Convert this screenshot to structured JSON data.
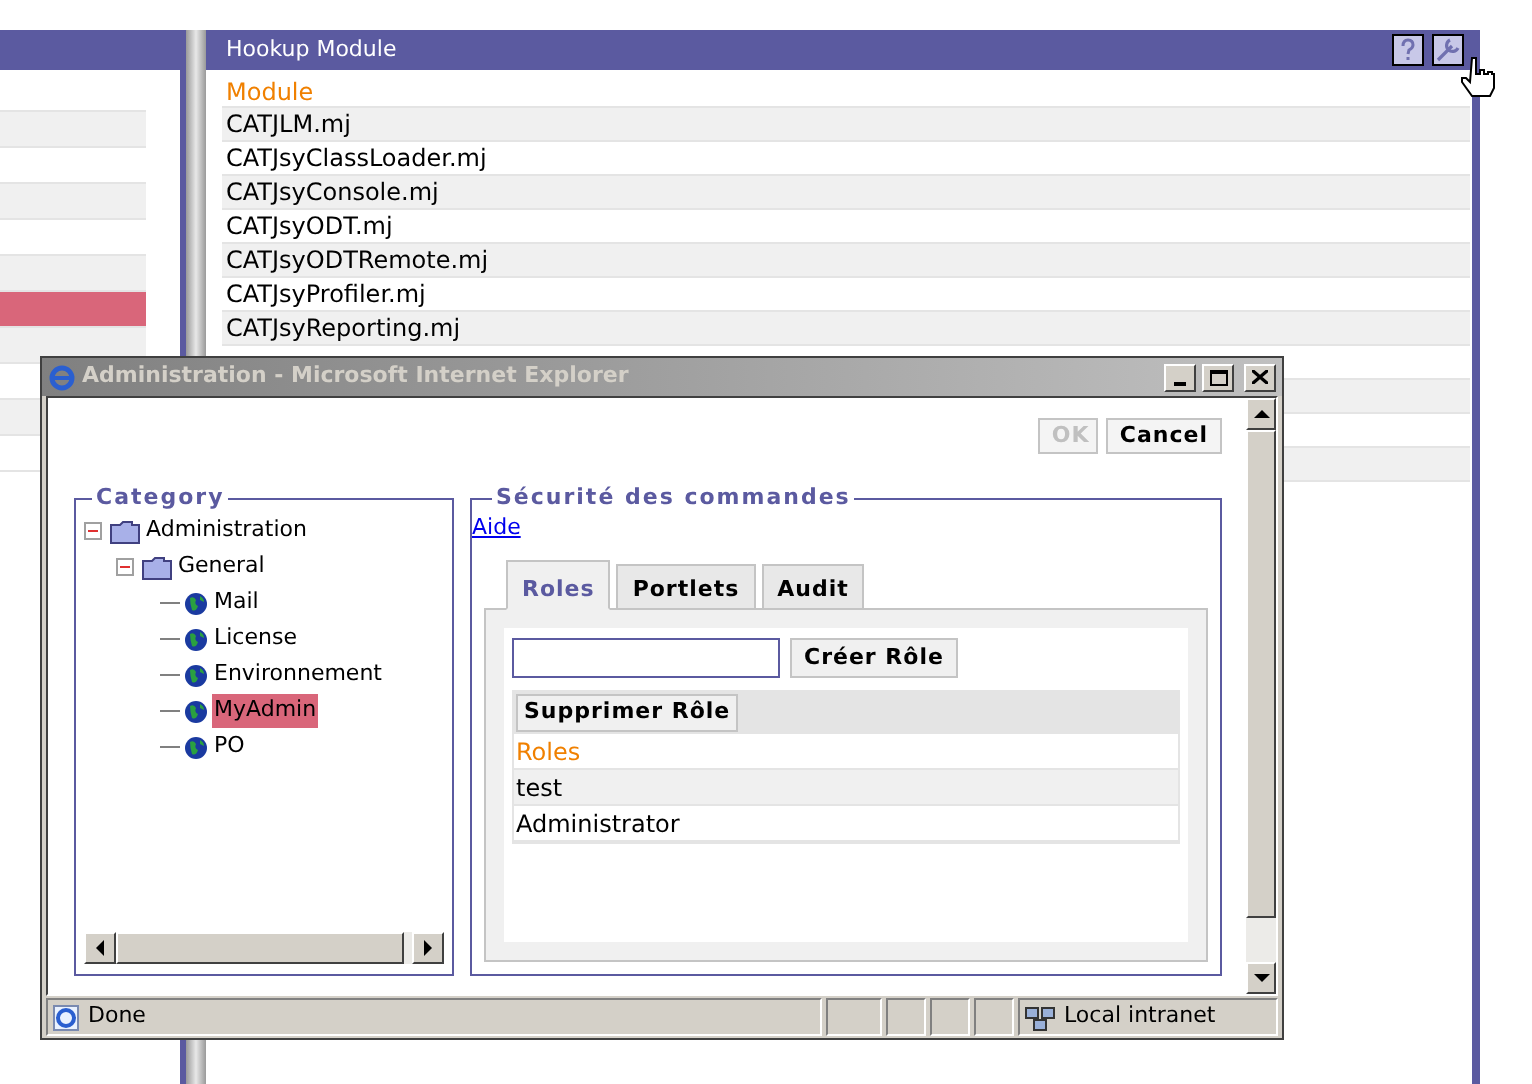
{
  "left_panel": {
    "rows": [
      {
        "selected": false
      },
      {
        "selected": false
      },
      {
        "selected": false
      },
      {
        "selected": false
      },
      {
        "selected": false
      },
      {
        "selected": false
      },
      {
        "selected": true
      },
      {
        "selected": false
      },
      {
        "selected": false
      },
      {
        "selected": false
      },
      {
        "selected": false
      }
    ]
  },
  "hookup_module": {
    "title": "Hookup Module",
    "column": "Module",
    "rows": [
      "CATJLM.mj",
      "CATJsyClassLoader.mj",
      "CATJsyConsole.mj",
      "CATJsyODT.mj",
      "CATJsyODTRemote.mj",
      "CATJsyProfiler.mj",
      "CATJsyReporting.mj"
    ]
  },
  "dialog": {
    "title": "Administration - Microsoft Internet Explorer",
    "active": false,
    "buttons": [
      {
        "label": "OK",
        "disabled": true
      },
      {
        "label": "Cancel",
        "disabled": false
      }
    ],
    "category": {
      "legend": "Category",
      "tree": [
        {
          "label": "Administration",
          "kind": "folder",
          "expanded": true,
          "children": [
            {
              "label": "General",
              "kind": "folder",
              "expanded": true,
              "children": [
                {
                  "label": "Mail",
                  "kind": "leaf",
                  "selected": false
                },
                {
                  "label": "License",
                  "kind": "leaf",
                  "selected": false
                },
                {
                  "label": "Environnement",
                  "kind": "leaf",
                  "selected": false
                },
                {
                  "label": "MyAdmin",
                  "kind": "leaf",
                  "selected": true
                },
                {
                  "label": "PO",
                  "kind": "leaf",
                  "selected": false
                }
              ]
            }
          ]
        }
      ]
    },
    "security": {
      "legend": "Sécurité des commandes",
      "help_link": "Aide",
      "tabs": [
        {
          "label": "Roles",
          "selected": true
        },
        {
          "label": "Portlets",
          "selected": false
        },
        {
          "label": "Audit",
          "selected": false
        }
      ],
      "create_button": "Créer Rôle",
      "delete_button": "Supprimer Rôle",
      "table": {
        "column": "Roles",
        "rows": [
          "test",
          "Administrator"
        ]
      }
    },
    "status_bar": {
      "text": "Done",
      "zone": "Local intranet"
    }
  }
}
